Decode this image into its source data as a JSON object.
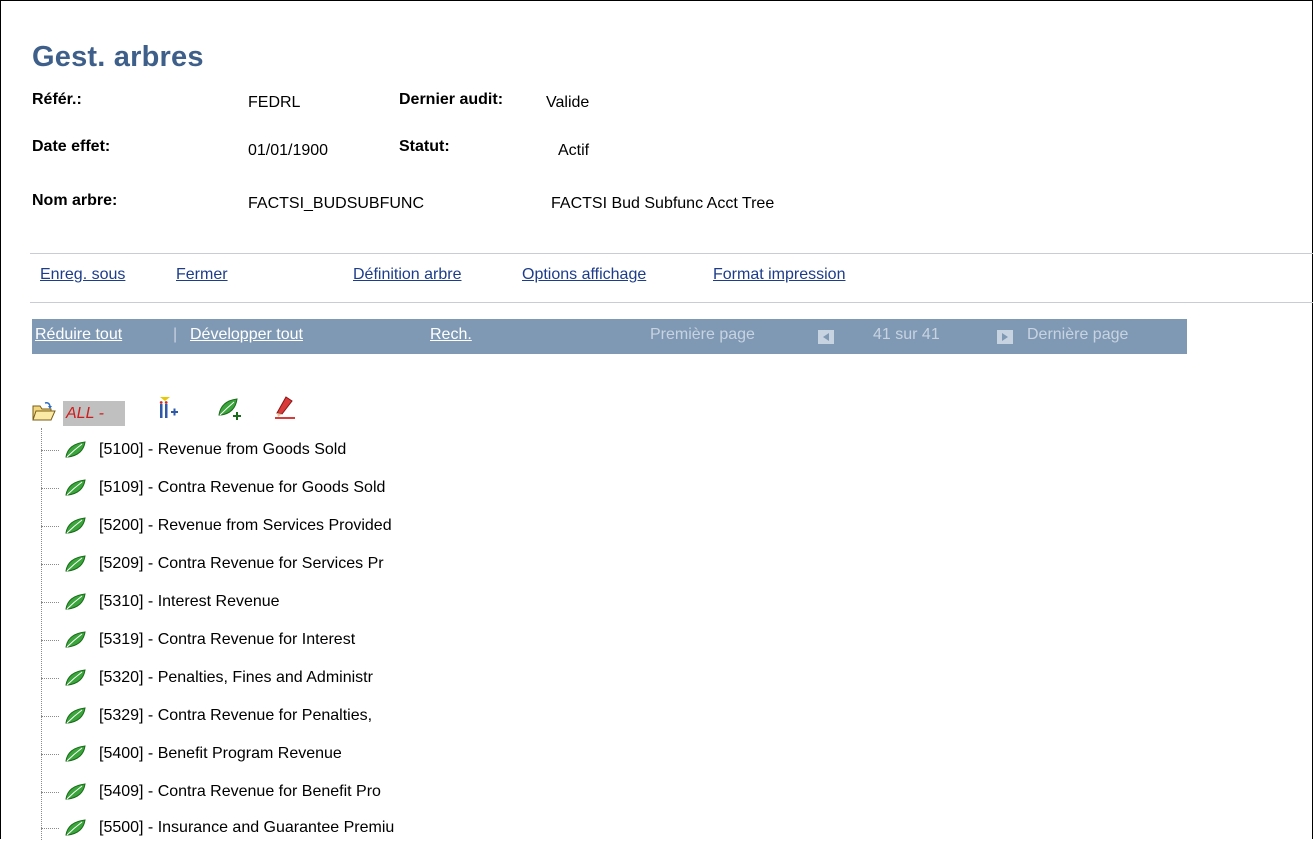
{
  "page": {
    "title": "Gest. arbres"
  },
  "info": {
    "ref_label": "Référ.:",
    "ref_value": "FEDRL",
    "audit_label": "Dernier audit:",
    "audit_value": "Valide",
    "date_label": "Date effet:",
    "date_value": "01/01/1900",
    "status_label": "Statut:",
    "status_value": "Actif",
    "name_label": "Nom arbre:",
    "name_value": "FACTSI_BUDSUBFUNC",
    "name_desc": "FACTSI Bud Subfunc Acct Tree"
  },
  "actions": {
    "save_as": "Enreg. sous",
    "close": "Fermer",
    "tree_definition": "Définition arbre",
    "display_options": "Options affichage",
    "print_format": "Format impression"
  },
  "nav": {
    "collapse_all": "Réduire tout",
    "separator": "|",
    "expand_all": "Développer tout",
    "search": "Rech.",
    "first_page": "Première page",
    "page_info": "41 sur 41",
    "last_page": "Dernière page"
  },
  "tree": {
    "root_label": "ALL -",
    "icons": [
      "folder-open-icon",
      "insert-child-icon",
      "insert-leaf-icon",
      "edit-icon"
    ],
    "nodes": [
      "[5100] - Revenue from Goods Sold",
      "[5109] - Contra Revenue for Goods Sold",
      "[5200] - Revenue from Services Provided",
      "[5209] - Contra Revenue for Services Pr",
      "[5310] - Interest Revenue",
      "[5319] - Contra Revenue for Interest",
      "[5320] - Penalties, Fines and Administr",
      "[5329] - Contra Revenue for Penalties,",
      "[5400] - Benefit Program Revenue",
      "[5409] - Contra Revenue for Benefit Pro",
      "[5500] - Insurance and Guarantee Premiu"
    ]
  },
  "colors": {
    "title": "#3e5f8a",
    "link": "#1d3d8a",
    "nav_bar": "#7f99b5",
    "nav_dim_text": "#c7d3e0",
    "root_text": "#cc1e1e",
    "leaf_green": "#3aa53a"
  }
}
